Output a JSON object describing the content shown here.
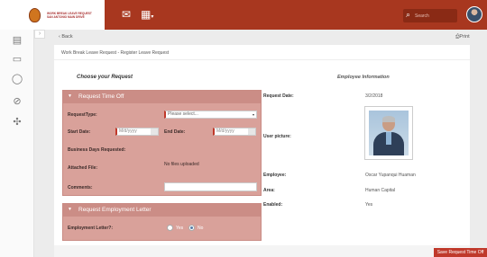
{
  "topbar": {
    "logo_lines": [
      "WORK BREAK LEAVE REQUEST",
      "SAN ANTONIO MAIN DRIVE"
    ],
    "nav_icons": [
      "inbox-icon",
      "calendar-icon"
    ],
    "search_placeholder": "Search",
    "colors": {
      "bar": "#a8371f",
      "accent": "#c0392b"
    }
  },
  "rail": {
    "icons": [
      "book-icon",
      "folder-icon",
      "chat-icon",
      "paperclip-icon",
      "puzzle-icon"
    ]
  },
  "subheader": {
    "back_label": "‹  Back",
    "print_label": "Print"
  },
  "breadcrumb": "Work Break Leave Request - Register Leave Request",
  "request": {
    "heading": "Choose your Request",
    "time_off": {
      "title": "Request Time Off",
      "request_type_label": "RequestType:",
      "request_type_value": "Please select...",
      "start_label": "Start Date:",
      "start_placeholder": "M/d/yyyy",
      "end_label": "End Date:",
      "end_placeholder": "M/d/yyyy",
      "business_days_label": "Business Days Requested:",
      "attached_label": "Attached File:",
      "attached_value": "No files uploaded",
      "comments_label": "Comments:"
    },
    "employment_letter": {
      "title": "Request Employment Letter",
      "label": "Employment Letter?:",
      "options": [
        "Yes",
        "No"
      ],
      "selected": "No"
    }
  },
  "employee": {
    "heading": "Employee Information",
    "request_date_label": "Request Date:",
    "request_date": "3/2/2018",
    "picture_label": "User picture:",
    "employee_label": "Employee:",
    "employee_name": "Oscar Yupanqui Huaman",
    "area_label": "Area:",
    "area": "Human Capital",
    "enabled_label": "Enabled:",
    "enabled": "Yes"
  },
  "submit_label": "Save Request Time Off"
}
